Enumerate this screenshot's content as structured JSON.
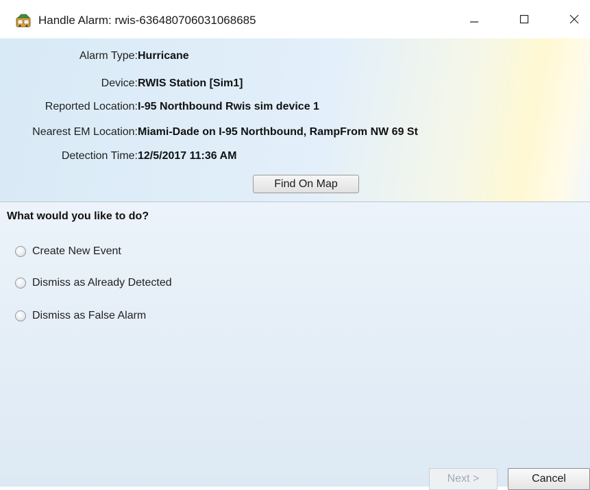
{
  "window": {
    "title": "Handle Alarm: rwis-636480706031068685",
    "icons": {
      "app": "alarm-app-icon",
      "minimize": "minimize-icon",
      "maximize": "maximize-icon",
      "close": "close-icon"
    }
  },
  "details": {
    "alarm_type_label": "Alarm Type:",
    "alarm_type_value": "Hurricane",
    "device_label": "Device:",
    "device_value": "RWIS Station [Sim1]",
    "reported_location_label": "Reported Location:",
    "reported_location_value": "I-95 Northbound Rwis sim device 1",
    "nearest_em_location_label": "Nearest EM Location:",
    "nearest_em_location_value": "Miami-Dade on I-95 Northbound, RampFrom NW 69 St",
    "detection_time_label": "Detection Time:",
    "detection_time_value": "12/5/2017 11:36 AM",
    "find_on_map_label": "Find On Map"
  },
  "actions": {
    "question": "What would you like to do?",
    "options": [
      {
        "label": "Create New Event",
        "selected": false
      },
      {
        "label": "Dismiss as Already Detected",
        "selected": false
      },
      {
        "label": "Dismiss as False Alarm",
        "selected": false
      }
    ]
  },
  "footer": {
    "next_label": "Next >",
    "next_enabled": false,
    "cancel_label": "Cancel"
  },
  "colors": {
    "panel_blue": "#d8eaf6",
    "panel_yellow": "#fff8d2",
    "options_bg": "#e4eef7"
  }
}
